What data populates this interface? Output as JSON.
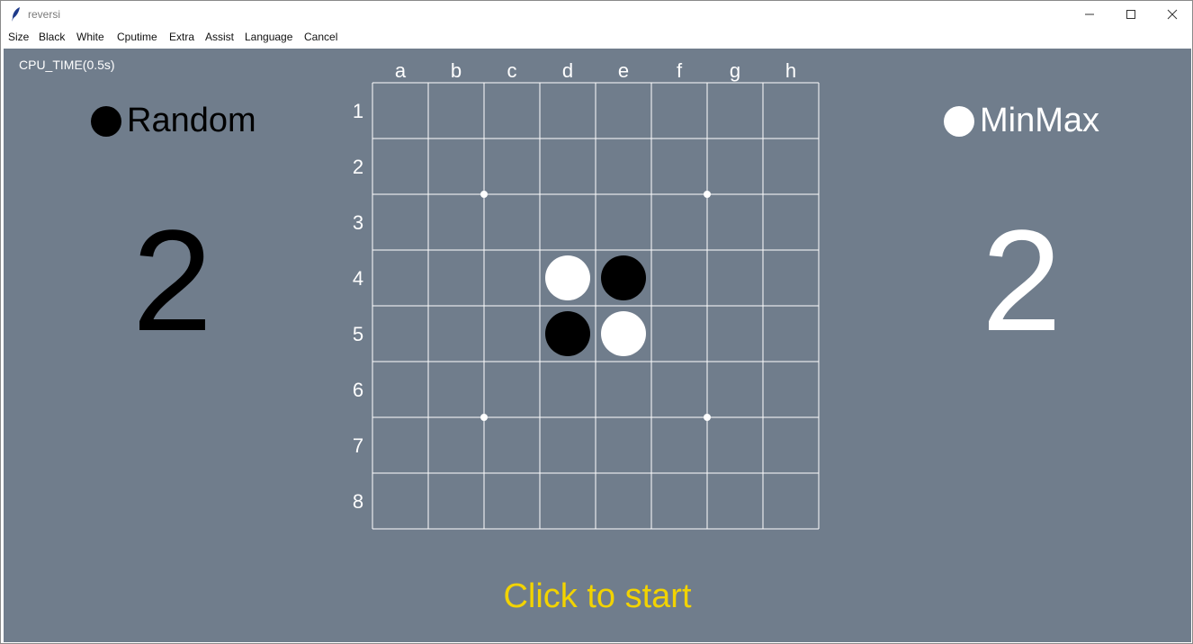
{
  "window": {
    "title": "reversi"
  },
  "menu": {
    "items": [
      "Size",
      "Black",
      "White",
      "Cputime",
      "Extra",
      "Assist",
      "Language",
      "Cancel"
    ]
  },
  "game": {
    "cpu_time_label": "CPU_TIME(0.5s)",
    "black_player": {
      "name": "Random",
      "score": "2"
    },
    "white_player": {
      "name": "MinMax",
      "score": "2"
    },
    "columns": [
      "a",
      "b",
      "c",
      "d",
      "e",
      "f",
      "g",
      "h"
    ],
    "rows": [
      "1",
      "2",
      "3",
      "4",
      "5",
      "6",
      "7",
      "8"
    ],
    "pieces": [
      {
        "cell": "d4",
        "color": "white"
      },
      {
        "cell": "e4",
        "color": "black"
      },
      {
        "cell": "d5",
        "color": "black"
      },
      {
        "cell": "e5",
        "color": "white"
      }
    ],
    "star_points": [
      "c3",
      "g3",
      "c7",
      "g7"
    ],
    "status_text": "Click to start"
  },
  "colors": {
    "background": "#707d8c",
    "grid": "#ffffff",
    "status": "#f2d300"
  }
}
